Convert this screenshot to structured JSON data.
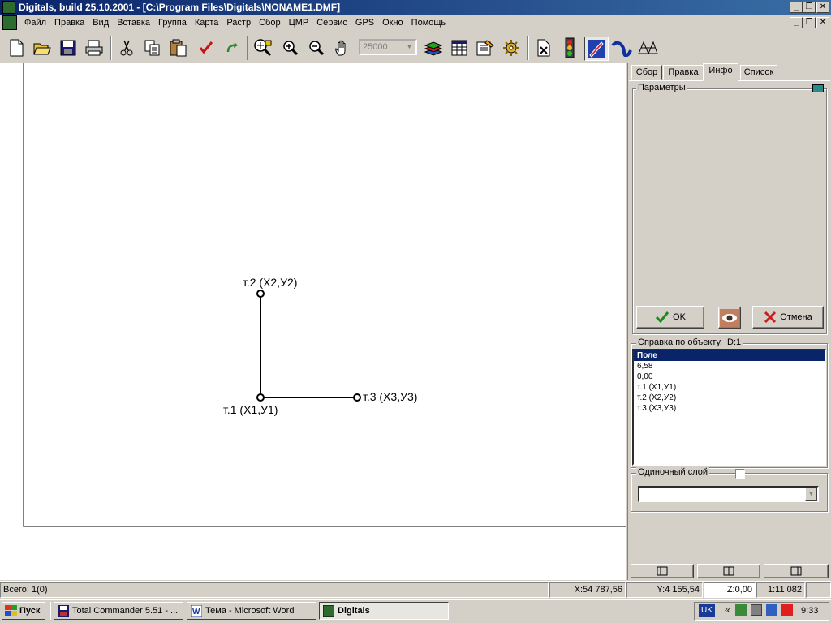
{
  "window": {
    "title": "Digitals, build 25.10.2001 - [C:\\Program Files\\Digitals\\NONAME1.DMF]",
    "min_glyph": "_",
    "restore_glyph": "❐",
    "close_glyph": "✕"
  },
  "menu": [
    "Файл",
    "Правка",
    "Вид",
    "Вставка",
    "Группа",
    "Карта",
    "Растр",
    "Сбор",
    "ЦМР",
    "Сервис",
    "GPS",
    "Окно",
    "Помощь"
  ],
  "toolbar": {
    "scale_value": "25000",
    "icons": [
      "new-file-icon",
      "open-folder-icon",
      "save-icon",
      "print-icon",
      "cut-icon",
      "copy-icon",
      "paste-icon",
      "checkmark-icon",
      "redo-icon",
      "zoom-window-icon",
      "zoom-in-icon",
      "zoom-out-icon",
      "pan-hand-icon",
      "layers-icon",
      "table-icon",
      "properties-icon",
      "settings-gear-icon",
      "delete-node-icon",
      "traffic-light-icon",
      "pen-tool-icon",
      "curve-icon",
      "mesh-icon"
    ]
  },
  "drawing": {
    "p1_label": "т.1 (X1,У1)",
    "p2_label": "т.2 (X2,У2)",
    "p3_label": "т.3 (X3,У3)"
  },
  "panel": {
    "tabs": [
      {
        "label": "Сбор",
        "active": false
      },
      {
        "label": "Правка",
        "active": false
      },
      {
        "label": "Инфо",
        "active": true
      },
      {
        "label": "Список",
        "active": false
      }
    ],
    "params_title": "Параметры",
    "ok_label": "OK",
    "cancel_label": "Отмена",
    "info_title": "Справка по объекту, ID:1",
    "info_items": [
      "Поле",
      "6,58",
      "0,00",
      "т.1 (X1,У1)",
      "т.2 (X2,У2)",
      "т.3 (X3,У3)"
    ],
    "single_layer_label": "Одиночный слой",
    "single_layer_checked": false,
    "layer_select_value": ""
  },
  "status": {
    "total": "Всего: 1(0)",
    "x": "X:54 787,56",
    "y": "Y:4 155,54",
    "z": "Z:0,00",
    "scale": "1:11 082"
  },
  "taskbar": {
    "start_label": "Пуск",
    "tasks": [
      {
        "label": "Total Commander 5.51 - ...",
        "active": false
      },
      {
        "label": "Тема - Microsoft Word",
        "active": false
      },
      {
        "label": "Digitals",
        "active": true
      }
    ],
    "lang": "UK",
    "clock": "9:33"
  },
  "colors": {
    "title_start": "#0a246a",
    "title_end": "#3a6ea5",
    "selection": "#0a246a",
    "ok_check": "#1e8a1e",
    "cancel_x": "#c81e1e"
  }
}
